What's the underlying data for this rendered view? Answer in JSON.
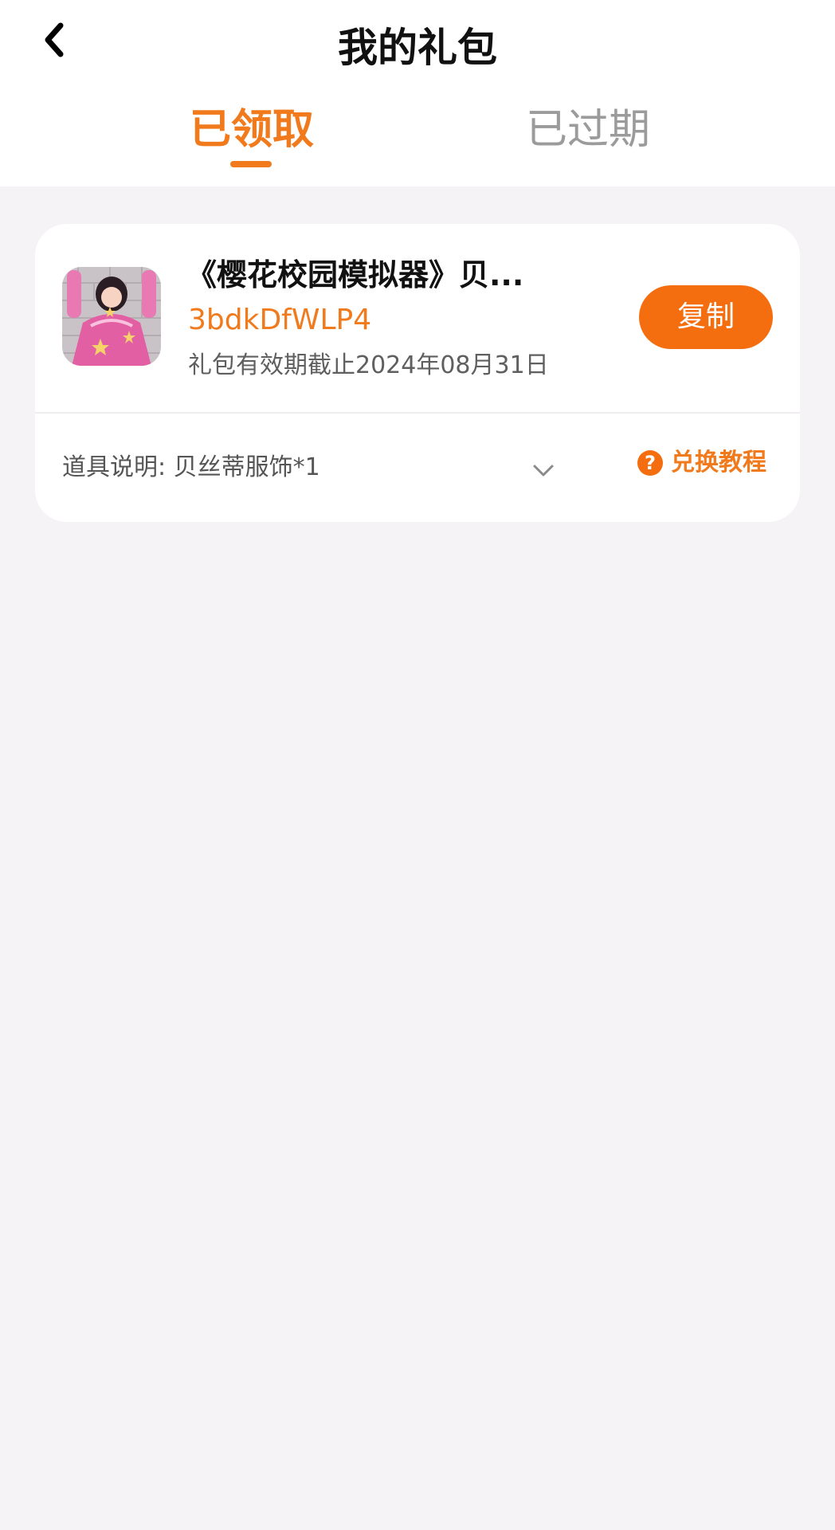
{
  "header": {
    "title": "我的礼包",
    "back_icon": "chevron-left-icon"
  },
  "tabs": [
    {
      "label": "已领取",
      "active": true
    },
    {
      "label": "已过期",
      "active": false
    }
  ],
  "gift": {
    "icon": "game-avatar-icon",
    "title": "《樱花校园模拟器》贝...",
    "code": "3bdkDfWLP4",
    "expiry": "礼包有效期截止2024年08月31日",
    "copy_label": "复制",
    "items_label": "道具说明:",
    "items_value": "贝丝蒂服饰*1",
    "guide_label": "兑换教程"
  },
  "colors": {
    "accent": "#f07a1c",
    "button": "#f46e10",
    "background": "#f6f3f7"
  }
}
